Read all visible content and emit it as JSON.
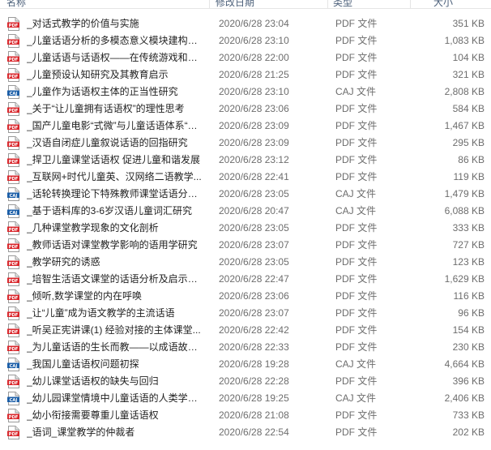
{
  "columns": {
    "name": "名称",
    "date": "修改日期",
    "type": "类型",
    "size": "大小"
  },
  "files": [
    {
      "name": "_对话式教学的价值与实施",
      "date": "2020/6/28 23:04",
      "type": "PDF 文件",
      "size": "351 KB",
      "icon": "pdf-file-icon"
    },
    {
      "name": "_儿童话语分析的多模态意义模块建构探...",
      "date": "2020/6/28 23:10",
      "type": "PDF 文件",
      "size": "1,083 KB",
      "icon": "pdf-file-icon"
    },
    {
      "name": "_儿童话语与话语权——在传统游戏和区...",
      "date": "2020/6/28 22:00",
      "type": "PDF 文件",
      "size": "104 KB",
      "icon": "pdf-file-icon"
    },
    {
      "name": "_儿童预设认知研究及其教育启示",
      "date": "2020/6/28 21:25",
      "type": "PDF 文件",
      "size": "321 KB",
      "icon": "pdf-file-icon"
    },
    {
      "name": "_儿童作为话语权主体的正当性研究",
      "date": "2020/6/28 23:10",
      "type": "CAJ 文件",
      "size": "2,808 KB",
      "icon": "caj-file-icon"
    },
    {
      "name": "_关于“让儿童拥有话语权”的理性思考",
      "date": "2020/6/28 23:06",
      "type": "PDF 文件",
      "size": "584 KB",
      "icon": "pdf-file-icon"
    },
    {
      "name": "_国产儿童电影“式微”与儿童话语体系“突...",
      "date": "2020/6/28 23:09",
      "type": "PDF 文件",
      "size": "1,467 KB",
      "icon": "pdf-file-icon"
    },
    {
      "name": "_汉语自闭症儿童叙说话语的回指研究",
      "date": "2020/6/28 23:09",
      "type": "PDF 文件",
      "size": "295 KB",
      "icon": "pdf-file-icon"
    },
    {
      "name": "_捍卫儿童课堂话语权  促进儿童和谐发展",
      "date": "2020/6/28 23:12",
      "type": "PDF 文件",
      "size": "86 KB",
      "icon": "pdf-file-icon"
    },
    {
      "name": "_互联网+时代儿童英、汉网络二语教学...",
      "date": "2020/6/28 22:41",
      "type": "PDF 文件",
      "size": "119 KB",
      "icon": "pdf-file-icon"
    },
    {
      "name": "_话轮转换理论下特殊教师课堂话语分析...",
      "date": "2020/6/28 23:05",
      "type": "CAJ 文件",
      "size": "1,479 KB",
      "icon": "caj-file-icon"
    },
    {
      "name": "_基于语料库的3-6岁汉语儿童词汇研究",
      "date": "2020/6/28 20:47",
      "type": "CAJ 文件",
      "size": "6,088 KB",
      "icon": "caj-file-icon"
    },
    {
      "name": "_几种课堂教学现象的文化剖析",
      "date": "2020/6/28 23:05",
      "type": "PDF 文件",
      "size": "333 KB",
      "icon": "pdf-file-icon"
    },
    {
      "name": "_教师话语对课堂教学影响的语用学研究",
      "date": "2020/6/28 23:07",
      "type": "PDF 文件",
      "size": "727 KB",
      "icon": "pdf-file-icon"
    },
    {
      "name": "_教学研究的诱惑",
      "date": "2020/6/28 23:05",
      "type": "PDF 文件",
      "size": "123 KB",
      "icon": "pdf-file-icon"
    },
    {
      "name": "_培智生活语文课堂的话语分析及启示—...",
      "date": "2020/6/28 22:47",
      "type": "PDF 文件",
      "size": "1,629 KB",
      "icon": "pdf-file-icon"
    },
    {
      "name": "_倾听,数学课堂的内在呼唤",
      "date": "2020/6/28 23:06",
      "type": "PDF 文件",
      "size": "116 KB",
      "icon": "pdf-file-icon"
    },
    {
      "name": "_让“儿童”成为语文教学的主流话语",
      "date": "2020/6/28 23:07",
      "type": "PDF 文件",
      "size": "96 KB",
      "icon": "pdf-file-icon"
    },
    {
      "name": "_听吴正宪讲课(1)  经验对接的主体课堂...",
      "date": "2020/6/28 22:42",
      "type": "PDF 文件",
      "size": "154 KB",
      "icon": "pdf-file-icon"
    },
    {
      "name": "_为儿童话语的生长而教——以成语故事...",
      "date": "2020/6/28 22:33",
      "type": "PDF 文件",
      "size": "230 KB",
      "icon": "pdf-file-icon"
    },
    {
      "name": "_我国儿童话语权问题初探",
      "date": "2020/6/28 19:28",
      "type": "CAJ 文件",
      "size": "4,664 KB",
      "icon": "caj-file-icon"
    },
    {
      "name": "_幼儿课堂话语权的缺失与回归",
      "date": "2020/6/28 22:28",
      "type": "PDF 文件",
      "size": "396 KB",
      "icon": "pdf-file-icon"
    },
    {
      "name": "_幼儿园课堂情境中儿童话语的人类学研究",
      "date": "2020/6/28 19:25",
      "type": "CAJ 文件",
      "size": "2,406 KB",
      "icon": "caj-file-icon"
    },
    {
      "name": "_幼小衔接需要尊重儿童话语权",
      "date": "2020/6/28 21:08",
      "type": "PDF 文件",
      "size": "733 KB",
      "icon": "pdf-file-icon"
    },
    {
      "name": "_语词_课堂教学的仲裁者",
      "date": "2020/6/28 22:54",
      "type": "PDF 文件",
      "size": "202 KB",
      "icon": "pdf-file-icon"
    }
  ],
  "icons": {
    "pdf-file-icon": {
      "label": "PDF",
      "color": "#d9262b"
    },
    "caj-file-icon": {
      "label": "CAJ",
      "color": "#1c5fa8"
    }
  }
}
